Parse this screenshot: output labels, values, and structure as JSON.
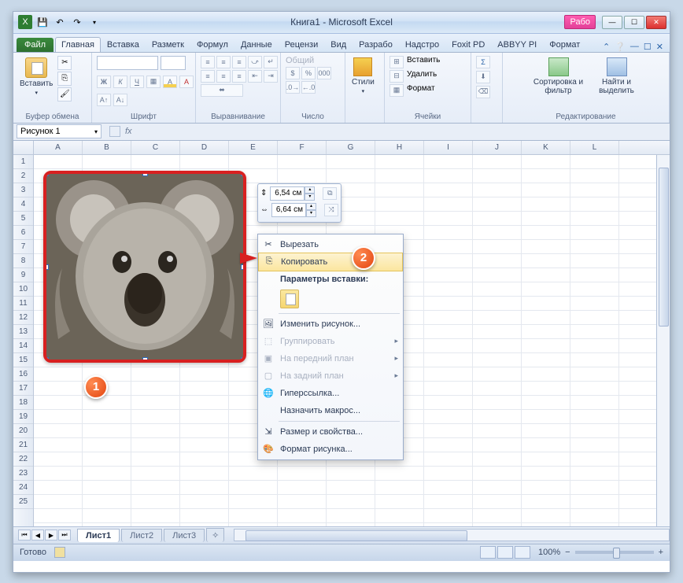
{
  "title": "Книга1 - Microsoft Excel",
  "highlight_tab": "Рабо",
  "tabs": {
    "file": "Файл",
    "items": [
      "Главная",
      "Вставка",
      "Разметк",
      "Формул",
      "Данные",
      "Рецензи",
      "Вид",
      "Разрабо",
      "Надстро",
      "Foxit PD",
      "ABBYY PI",
      "Формат"
    ]
  },
  "ribbon": {
    "clipboard": {
      "paste": "Вставить",
      "label": "Буфер обмена"
    },
    "font": {
      "label": "Шрифт"
    },
    "align": {
      "label": "Выравнивание"
    },
    "number": {
      "sel": "Общий",
      "label": "Число"
    },
    "styles": {
      "btn": "Стили"
    },
    "cells": {
      "insert": "Вставить",
      "delete": "Удалить",
      "format": "Формат",
      "label": "Ячейки"
    },
    "editing": {
      "sort": "Сортировка и фильтр",
      "find": "Найти и выделить",
      "label": "Редактирование"
    }
  },
  "name_box": "Рисунок 1",
  "fx": "fx",
  "columns": [
    "A",
    "B",
    "C",
    "D",
    "E",
    "F",
    "G",
    "H",
    "I",
    "J",
    "K",
    "L"
  ],
  "rows": [
    "1",
    "2",
    "3",
    "4",
    "5",
    "6",
    "7",
    "8",
    "9",
    "10",
    "11",
    "12",
    "13",
    "14",
    "15",
    "16",
    "17",
    "18",
    "19",
    "20",
    "21",
    "22",
    "23",
    "24",
    "25"
  ],
  "mini_toolbar": {
    "h": "6,54 см",
    "w": "6,64 см"
  },
  "context_menu": {
    "cut": "Вырезать",
    "copy": "Копировать",
    "paste_options": "Параметры вставки:",
    "change_pic": "Изменить рисунок...",
    "group": "Группировать",
    "front": "На передний план",
    "back": "На задний план",
    "hyperlink": "Гиперссылка...",
    "macro": "Назначить макрос...",
    "size": "Размер и свойства...",
    "format": "Формат рисунка..."
  },
  "badges": {
    "one": "1",
    "two": "2"
  },
  "sheet_tabs": [
    "Лист1",
    "Лист2",
    "Лист3"
  ],
  "status": {
    "ready": "Готово",
    "zoom": "100%",
    "minus": "−",
    "plus": "+"
  }
}
